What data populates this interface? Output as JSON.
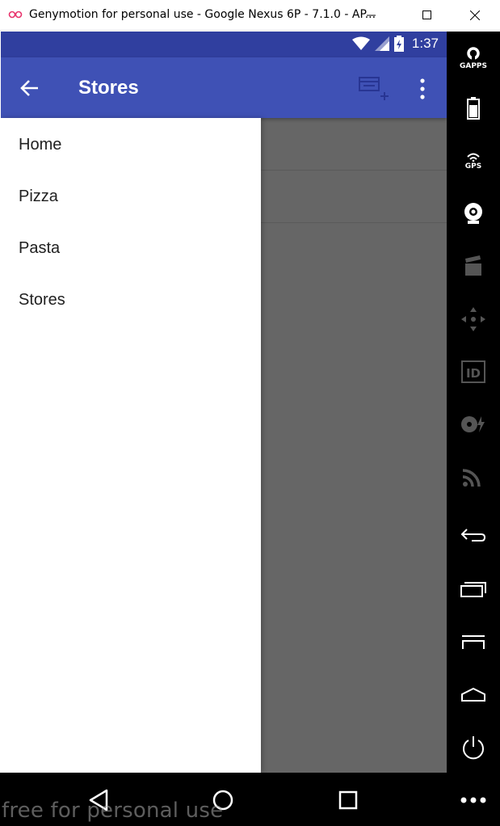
{
  "window": {
    "title": "Genymotion for personal use - Google Nexus 6P - 7.1.0 - AP...",
    "minimize_icon": "minimize-icon",
    "maximize_icon": "maximize-icon",
    "close_icon": "close-icon"
  },
  "statusbar": {
    "time": "1:37",
    "icons": [
      "wifi-icon",
      "signal-icon",
      "battery-charging-icon"
    ]
  },
  "appbar": {
    "title": "Stores",
    "back_icon": "arrow-back-icon",
    "action_icon": "add-to-list-icon",
    "overflow_icon": "more-vert-icon",
    "color": "#3f51b5",
    "status_color": "#303f9f"
  },
  "drawer": {
    "items": [
      {
        "label": "Home"
      },
      {
        "label": "Pizza"
      },
      {
        "label": "Pasta"
      },
      {
        "label": "Stores"
      }
    ]
  },
  "sidebar": {
    "tools": [
      {
        "icon": "gapps-icon",
        "label": "GAPPS"
      },
      {
        "icon": "battery-icon",
        "label": ""
      },
      {
        "icon": "gps-icon",
        "label": "GPS"
      },
      {
        "icon": "webcam-icon",
        "label": ""
      },
      {
        "icon": "media-clapper-icon",
        "label": ""
      },
      {
        "icon": "dpad-icon",
        "label": ""
      },
      {
        "icon": "device-id-icon",
        "label": ""
      },
      {
        "icon": "disk-io-icon",
        "label": ""
      },
      {
        "icon": "network-cast-icon",
        "label": ""
      },
      {
        "icon": "back-icon",
        "label": ""
      },
      {
        "icon": "recent-apps-icon",
        "label": ""
      },
      {
        "icon": "menu-icon",
        "label": ""
      },
      {
        "icon": "home-icon",
        "label": ""
      },
      {
        "icon": "power-icon",
        "label": ""
      },
      {
        "icon": "more-horiz-icon",
        "label": ""
      }
    ]
  },
  "navbar": {
    "buttons": [
      "nav-back-icon",
      "nav-home-icon",
      "nav-recents-icon"
    ]
  },
  "watermark": "free for personal use"
}
